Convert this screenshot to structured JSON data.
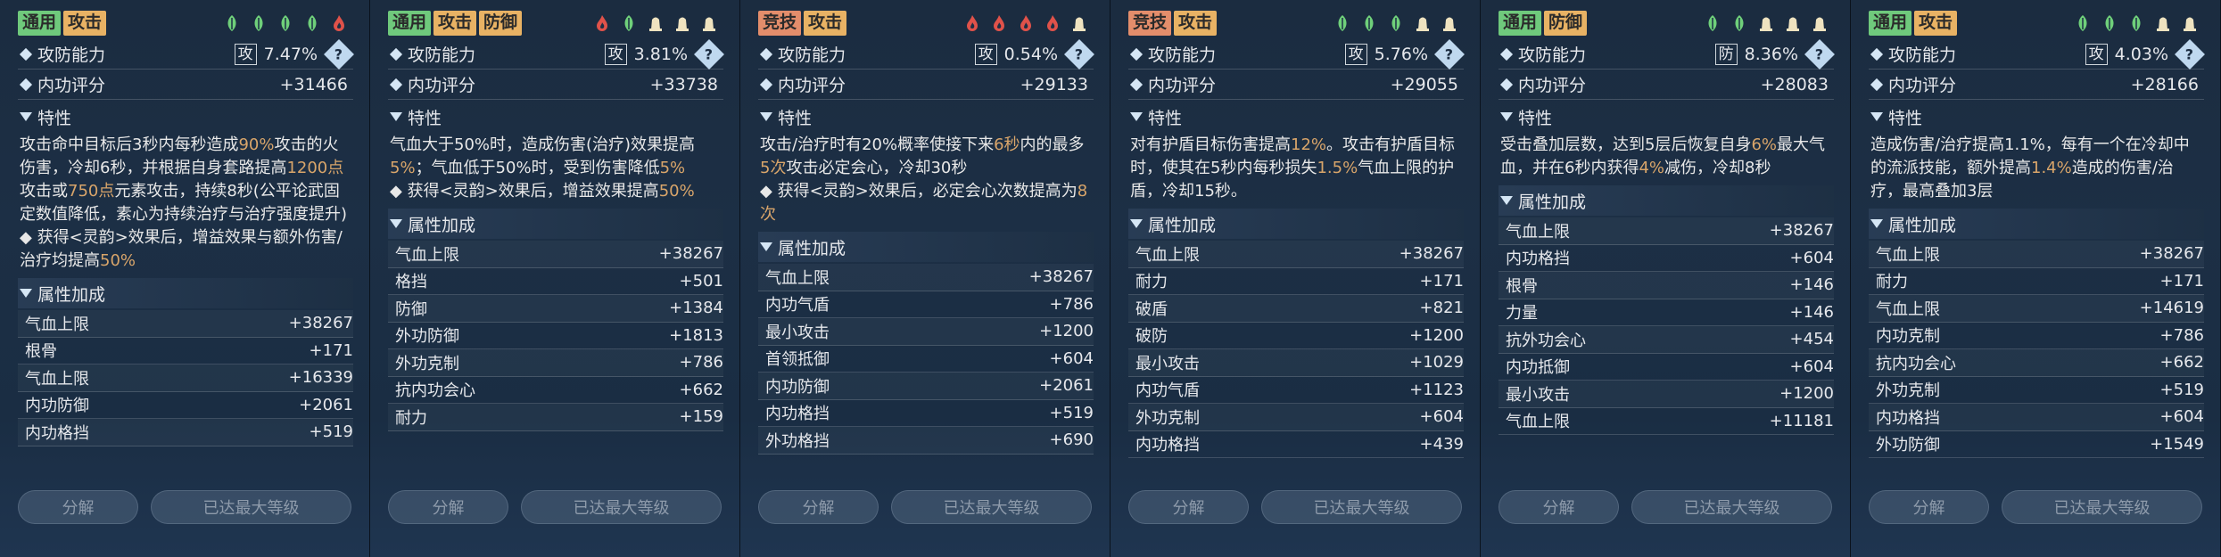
{
  "common": {
    "stat1": "攻防能力",
    "stat2": "内功评分",
    "trait": "特性",
    "attrs_title": "属性加成",
    "btn_decompose": "分解",
    "btn_maxlevel": "已达最大等级",
    "q": "?"
  },
  "cards": [
    {
      "tags": [
        {
          "text": "通用",
          "c": "green"
        },
        {
          "text": "攻击",
          "c": "orange"
        }
      ],
      "icons": [
        "leaf-green",
        "leaf-green",
        "leaf-green",
        "leaf-green",
        "flame-red"
      ],
      "badge": "攻",
      "pct": "7.47%",
      "score": "+31466",
      "desc": [
        [
          "攻击命中目标后3秒内每秒造成",
          ""
        ],
        [
          "90%",
          "hl"
        ],
        [
          "攻击的火伤害，冷却6秒，并根据自身套路提高",
          ""
        ],
        [
          "1200点",
          "hl"
        ],
        [
          "攻击或",
          ""
        ],
        [
          "750点",
          "hl"
        ],
        [
          "元素攻击，持续8秒(公平论武固定数值降低，素心为持续治疗与治疗强度提升)\n◆ 获得<灵韵>效果后，增益效果与额外伤害/治疗均提高",
          ""
        ],
        [
          "50%",
          "hl"
        ]
      ],
      "attrs": [
        [
          "气血上限",
          "+38267"
        ],
        [
          "根骨",
          "+171"
        ],
        [
          "气血上限",
          "+16339"
        ],
        [
          "内功防御",
          "+2061"
        ],
        [
          "内功格挡",
          "+519"
        ]
      ]
    },
    {
      "tags": [
        {
          "text": "通用",
          "c": "green"
        },
        {
          "text": "攻击",
          "c": "orange"
        },
        {
          "text": "防御",
          "c": "orange"
        }
      ],
      "icons": [
        "flame-red",
        "leaf-green",
        "bell-cream",
        "bell-cream",
        "bell-cream"
      ],
      "badge": "攻",
      "pct": "3.81%",
      "score": "+33738",
      "desc": [
        [
          "气血大于50%时，造成伤害(治疗)效果提高",
          ""
        ],
        [
          "5%",
          "hl"
        ],
        [
          "；气血低于50%时，受到伤害降低",
          ""
        ],
        [
          "5%",
          "hl"
        ],
        [
          "\n◆ 获得<灵韵>效果后，增益效果提高",
          ""
        ],
        [
          "50%",
          "hl"
        ]
      ],
      "attrs": [
        [
          "气血上限",
          "+38267"
        ],
        [
          "格挡",
          "+501"
        ],
        [
          "防御",
          "+1384"
        ],
        [
          "外功防御",
          "+1813"
        ],
        [
          "外功克制",
          "+786"
        ],
        [
          "抗内功会心",
          "+662"
        ],
        [
          "耐力",
          "+159"
        ]
      ]
    },
    {
      "tags": [
        {
          "text": "竞技",
          "c": "red"
        },
        {
          "text": "攻击",
          "c": "orange"
        }
      ],
      "icons": [
        "flame-red",
        "flame-red",
        "flame-red",
        "flame-red",
        "bell-cream"
      ],
      "badge": "攻",
      "pct": "0.54%",
      "score": "+29133",
      "desc": [
        [
          "攻击/治疗时有20%概率使接下来",
          ""
        ],
        [
          "6秒",
          "hl"
        ],
        [
          "内的最多",
          ""
        ],
        [
          "5次",
          "hl"
        ],
        [
          "攻击必定会心，冷却30秒\n◆ 获得<灵韵>效果后，必定会心次数提高为",
          ""
        ],
        [
          "8次",
          "hl"
        ]
      ],
      "attrs": [
        [
          "气血上限",
          "+38267"
        ],
        [
          "内功气盾",
          "+786"
        ],
        [
          "最小攻击",
          "+1200"
        ],
        [
          "首领抵御",
          "+604"
        ],
        [
          "内功防御",
          "+2061"
        ],
        [
          "内功格挡",
          "+519"
        ],
        [
          "外功格挡",
          "+690"
        ]
      ]
    },
    {
      "tags": [
        {
          "text": "竞技",
          "c": "red"
        },
        {
          "text": "攻击",
          "c": "orange"
        }
      ],
      "icons": [
        "leaf-green",
        "leaf-green",
        "leaf-green",
        "bell-cream",
        "bell-cream"
      ],
      "badge": "攻",
      "pct": "5.76%",
      "score": "+29055",
      "desc": [
        [
          "对有护盾目标伤害提高",
          ""
        ],
        [
          "12%",
          "hl"
        ],
        [
          "。攻击有护盾目标时，使其在5秒内每秒损失",
          ""
        ],
        [
          "1.5%",
          "hl"
        ],
        [
          "气血上限的护盾，冷却15秒。",
          ""
        ]
      ],
      "attrs": [
        [
          "气血上限",
          "+38267"
        ],
        [
          "耐力",
          "+171"
        ],
        [
          "破盾",
          "+821"
        ],
        [
          "破防",
          "+1200"
        ],
        [
          "最小攻击",
          "+1029"
        ],
        [
          "内功气盾",
          "+1123"
        ],
        [
          "外功克制",
          "+604"
        ],
        [
          "内功格挡",
          "+439"
        ]
      ]
    },
    {
      "tags": [
        {
          "text": "通用",
          "c": "green"
        },
        {
          "text": "防御",
          "c": "orange"
        }
      ],
      "icons": [
        "leaf-green",
        "leaf-green",
        "bell-cream",
        "bell-cream",
        "bell-cream"
      ],
      "badge": "防",
      "pct": "8.36%",
      "score": "+28083",
      "desc": [
        [
          "受击叠加层数，达到5层后恢复自身",
          ""
        ],
        [
          "6%",
          "hl"
        ],
        [
          "最大气血，并在6秒内获得",
          ""
        ],
        [
          "4%",
          "hl"
        ],
        [
          "减伤，冷却8秒",
          ""
        ]
      ],
      "attrs": [
        [
          "气血上限",
          "+38267"
        ],
        [
          "内功格挡",
          "+604"
        ],
        [
          "根骨",
          "+146"
        ],
        [
          "力量",
          "+146"
        ],
        [
          "抗外功会心",
          "+454"
        ],
        [
          "内功抵御",
          "+604"
        ],
        [
          "最小攻击",
          "+1200"
        ],
        [
          "气血上限",
          "+11181"
        ]
      ]
    },
    {
      "tags": [
        {
          "text": "通用",
          "c": "green"
        },
        {
          "text": "攻击",
          "c": "orange"
        }
      ],
      "icons": [
        "leaf-green",
        "leaf-green",
        "leaf-green",
        "bell-cream",
        "bell-cream"
      ],
      "badge": "攻",
      "pct": "4.03%",
      "score": "+28166",
      "desc": [
        [
          "造成伤害/治疗提高1.1%，每有一个在冷却中的流派技能，额外提高",
          ""
        ],
        [
          "1.4%",
          "hl"
        ],
        [
          "造成的伤害/治疗，最高叠加3层",
          ""
        ]
      ],
      "attrs": [
        [
          "气血上限",
          "+38267"
        ],
        [
          "耐力",
          "+171"
        ],
        [
          "气血上限",
          "+14619"
        ],
        [
          "内功克制",
          "+786"
        ],
        [
          "抗内功会心",
          "+662"
        ],
        [
          "外功克制",
          "+519"
        ],
        [
          "内功格挡",
          "+604"
        ],
        [
          "外功防御",
          "+1549"
        ]
      ]
    }
  ],
  "colors": {
    "leaf-green": "#6fd07a",
    "flame-red": "#e0524a",
    "bell-cream": "#efe3c0",
    "highlight": "#d9a56a"
  }
}
